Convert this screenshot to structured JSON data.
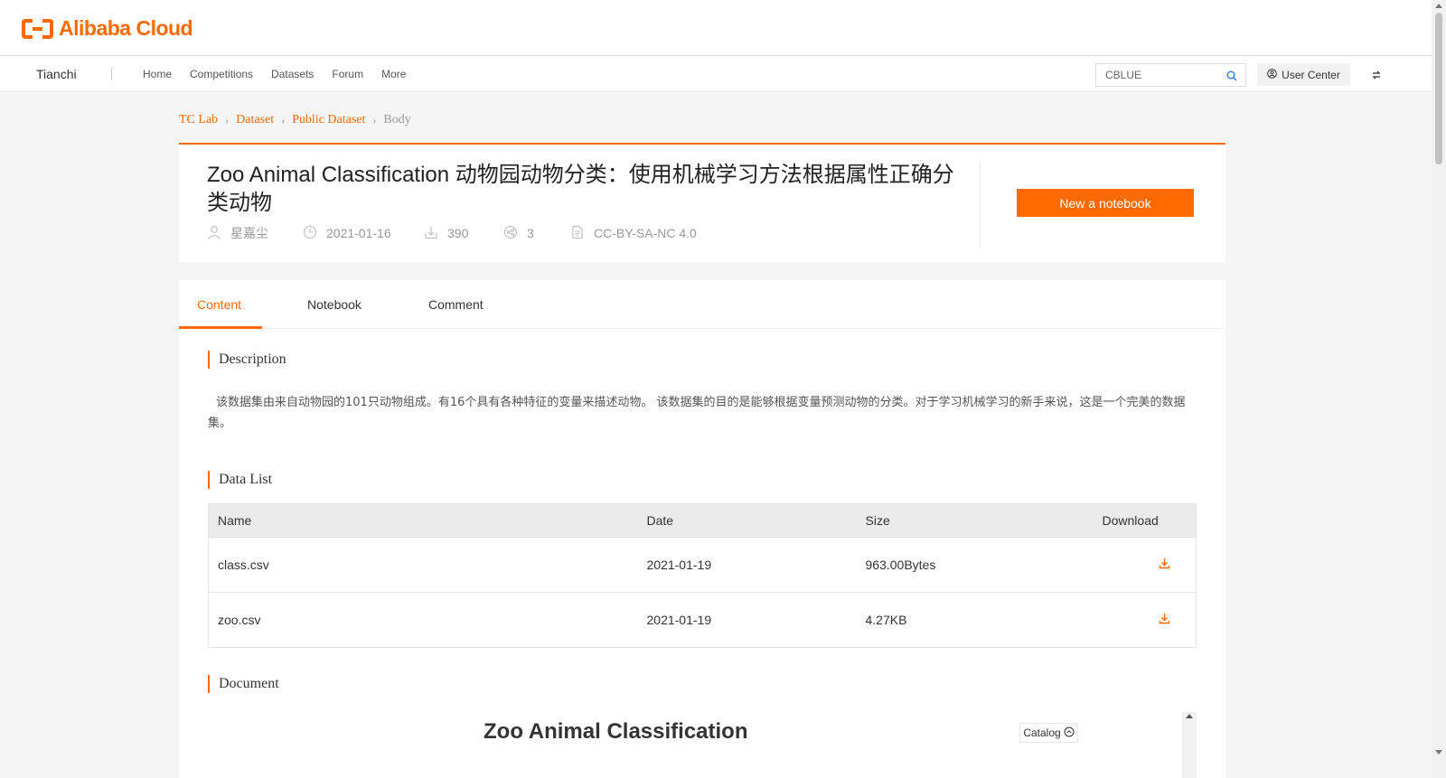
{
  "brand": {
    "logo_text": "Alibaba Cloud"
  },
  "nav": {
    "site": "Tianchi",
    "links": [
      "Home",
      "Competitions",
      "Datasets",
      "Forum",
      "More"
    ],
    "search_value": "CBLUE",
    "user_center": "User Center"
  },
  "breadcrumb": [
    "TC Lab",
    "Dataset",
    "Public Dataset",
    "Body"
  ],
  "dataset": {
    "title": "Zoo Animal Classification 动物园动物分类：使用机械学习方法根据属性正确分类动物",
    "author": "星嘉尘",
    "date": "2021-01-16",
    "downloads": "390",
    "shares": "3",
    "license": "CC-BY-SA-NC 4.0",
    "new_notebook_label": "New a notebook"
  },
  "tabs": [
    "Content",
    "Notebook",
    "Comment"
  ],
  "sections": {
    "description_title": "Description",
    "description_text": "该数据集由来自动物园的101只动物组成。有16个具有各种特征的变量来描述动物。 该数据集的目的是能够根据变量预测动物的分类。对于学习机械学习的新手来说，这是一个完美的数据集。",
    "data_list_title": "Data List",
    "document_title": "Document"
  },
  "table": {
    "headers": [
      "Name",
      "Date",
      "Size",
      "Download"
    ],
    "rows": [
      {
        "name": "class.csv",
        "date": "2021-01-19",
        "size": "963.00Bytes"
      },
      {
        "name": "zoo.csv",
        "date": "2021-01-19",
        "size": "4.27KB"
      }
    ]
  },
  "document": {
    "heading": "Zoo Animal Classification",
    "catalog_label": "Catalog"
  },
  "colors": {
    "accent": "#ff6a00"
  }
}
